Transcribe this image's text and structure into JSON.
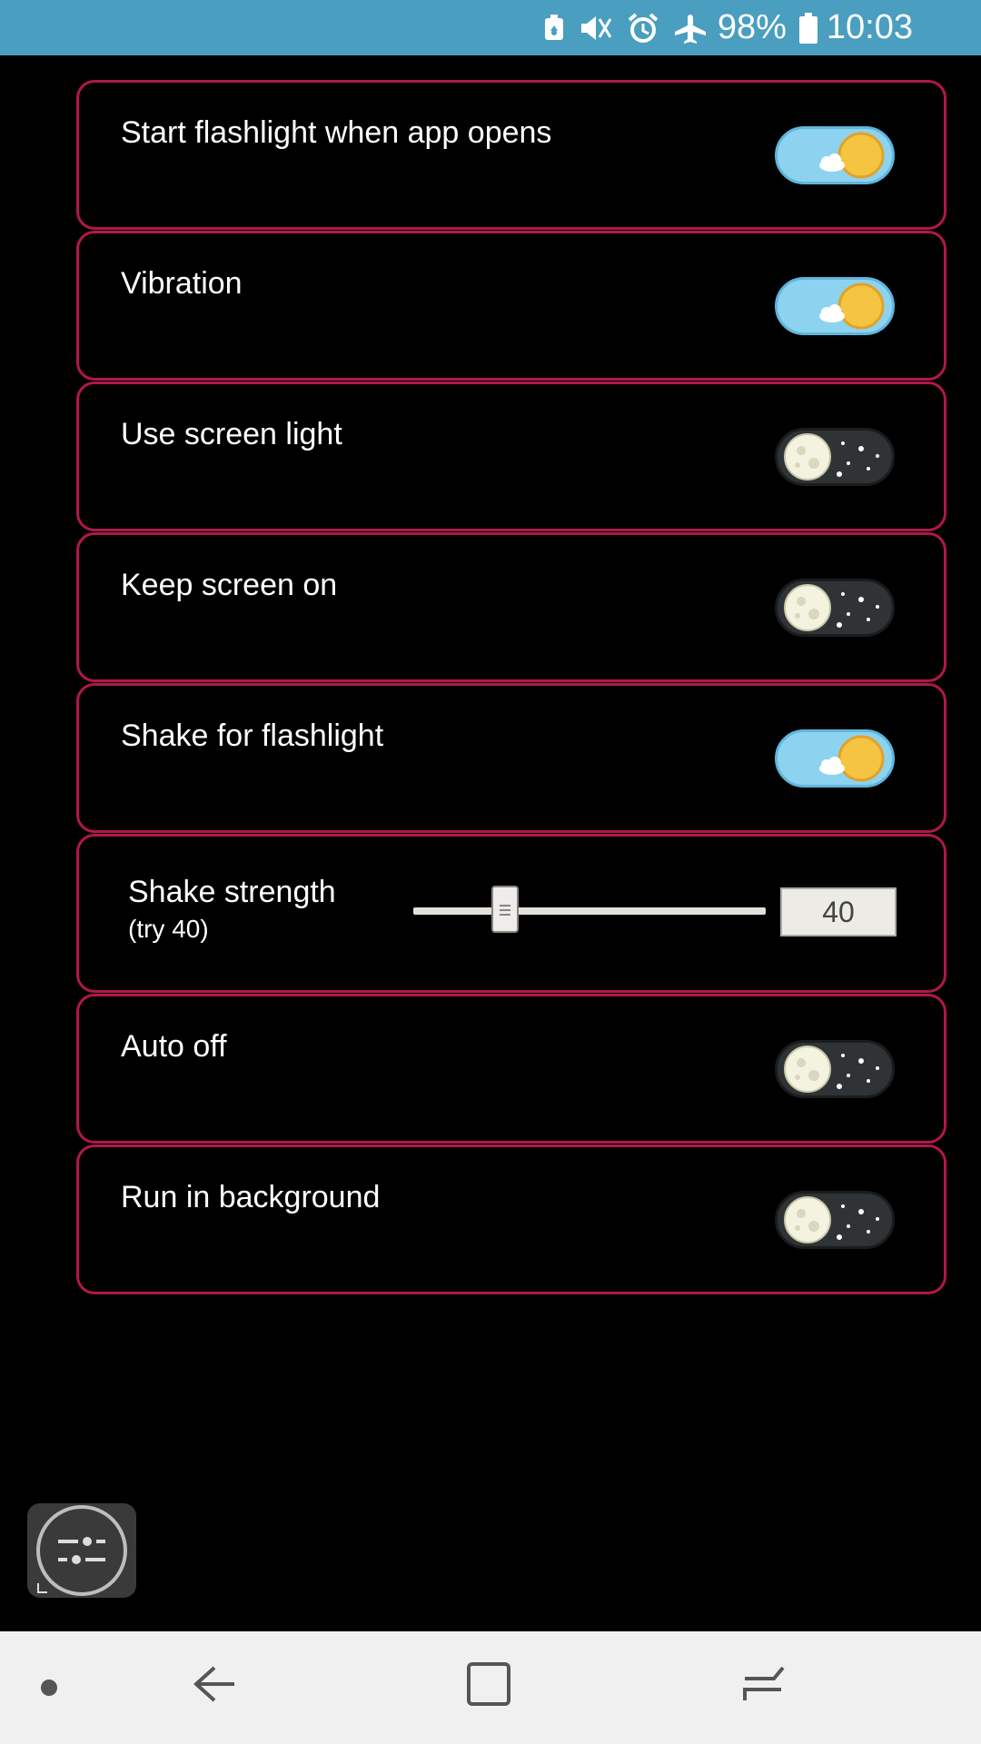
{
  "status_bar": {
    "battery_percent": "98%",
    "time": "10:03",
    "icons": [
      "battery-saver-icon",
      "vibrate-off-icon",
      "alarm-icon",
      "airplane-mode-icon",
      "battery-icon"
    ]
  },
  "settings": [
    {
      "label": "Start flashlight when app opens",
      "state": "on"
    },
    {
      "label": "Vibration",
      "state": "on"
    },
    {
      "label": "Use screen light",
      "state": "off"
    },
    {
      "label": "Keep screen on",
      "state": "off"
    },
    {
      "label": "Shake for flashlight",
      "state": "on"
    },
    {
      "label": "Auto off",
      "state": "off"
    },
    {
      "label": "Run in background",
      "state": "off"
    }
  ],
  "shake_strength": {
    "label": "Shake strength",
    "hint": "(try 40)",
    "value": "40"
  },
  "floating_button": {
    "icon": "equalizer-icon"
  },
  "nav_bar": {
    "icons": [
      "dot-icon",
      "back-icon",
      "home-icon",
      "recents-icon"
    ]
  },
  "colors": {
    "status_bar": "#4a9ec0",
    "row_border": "#b0184a",
    "toggle_on": "#8dd3f0",
    "toggle_off": "#2f3336",
    "sun": "#f5c542",
    "background": "#000000"
  }
}
